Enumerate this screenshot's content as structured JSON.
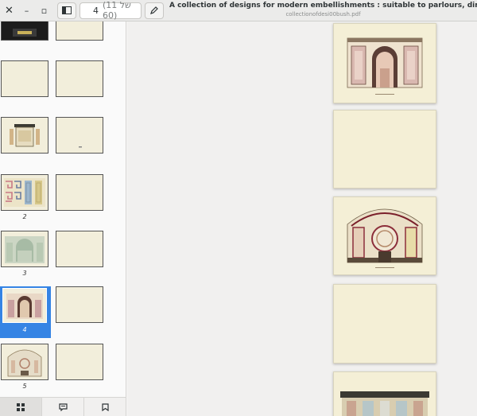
{
  "window": {
    "close_icon": "close-icon",
    "minimize_icon": "minimize-icon",
    "maximize_icon": "maximize-icon"
  },
  "header": {
    "page_value": "4",
    "page_total": "(11 של 60)",
    "title": "A collection of designs for modern embellishments : suitable to parlours, dining & drawing rooms, fo",
    "subtitle": "collectionofdesi00bush.pdf"
  },
  "sidebar": {
    "page_labels": [
      "2",
      "3",
      "4",
      "5"
    ],
    "selected_label": "4",
    "tabs": [
      "thumbnails-icon",
      "annotations-icon",
      "bookmarks-icon"
    ]
  },
  "colors": {
    "accent": "#3584e4",
    "paper": "#f2eedb"
  }
}
